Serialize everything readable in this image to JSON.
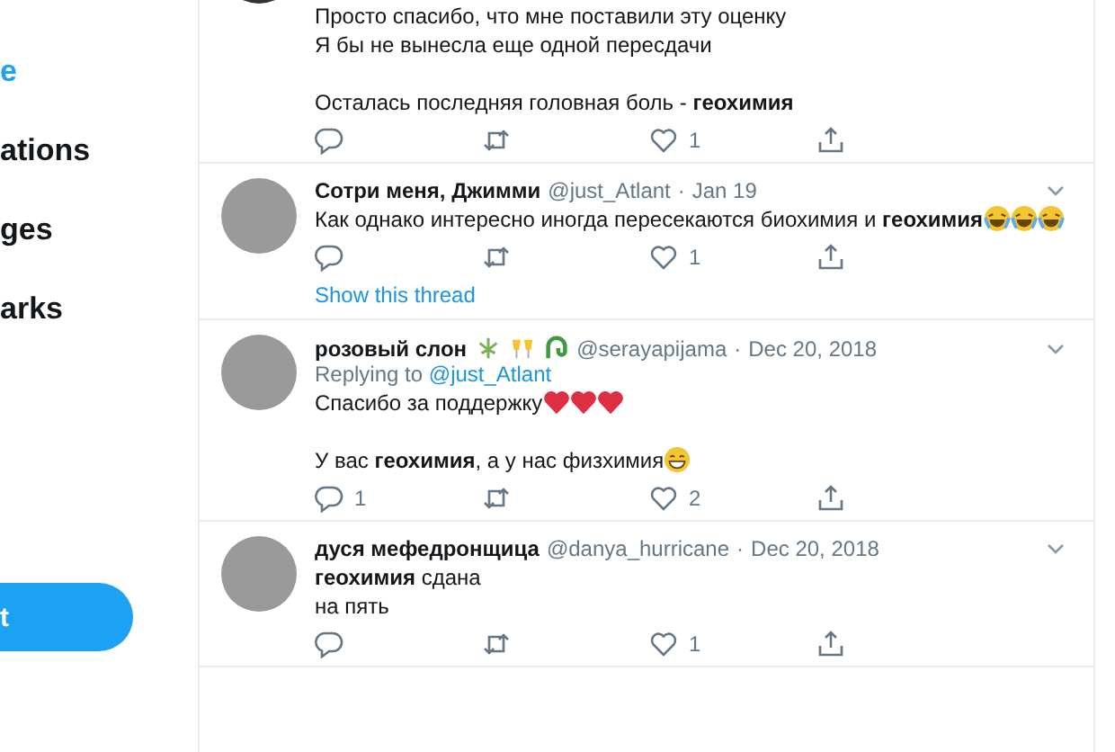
{
  "sidebar": {
    "items": [
      {
        "label": "e",
        "selected": true
      },
      {
        "label": "ations",
        "selected": false
      },
      {
        "label": "ges",
        "selected": false
      },
      {
        "label": "arks",
        "selected": false
      }
    ],
    "button": "t"
  },
  "tweets": [
    {
      "paragraphs": [
        {
          "text": "Просто спасибо, что мне поставили эту оценку\nЯ бы не вынесла еще одной пересдачи"
        },
        {
          "text": "Осталась последняя головная боль - **геохимия**"
        }
      ],
      "actions": {
        "likes": "1"
      }
    },
    {
      "name": "Сотри меня, Джимми",
      "handle": "@just_Atlant",
      "separator": "·",
      "date": "Jan 19",
      "paragraphs": [
        {
          "text": "Как однако интересно иногда пересекаются биохимия и **геохимия**",
          "emojis": [
            {
              "kind": "laugh"
            },
            {
              "kind": "laugh"
            },
            {
              "kind": "laugh"
            }
          ]
        }
      ],
      "actions": {
        "likes": "1"
      },
      "show_thread": "Show this thread"
    },
    {
      "name": "розовый слон",
      "name_emojis": [
        {
          "kind": "herb"
        },
        {
          "kind": "glasses"
        },
        {
          "kind": "snake"
        }
      ],
      "handle": "@serayapijama",
      "separator": "·",
      "date": "Dec 20, 2018",
      "replying_label": "Replying to",
      "replying_to": "@just_Atlant",
      "paragraphs": [
        {
          "text": "Спасибо за поддержку",
          "emojis": [
            {
              "kind": "heart"
            },
            {
              "kind": "heart"
            },
            {
              "kind": "heart"
            }
          ]
        },
        {
          "text": "У вас **геохимия**, а у нас физхимия",
          "emojis": [
            {
              "kind": "grin"
            }
          ]
        }
      ],
      "actions": {
        "replies": "1",
        "likes": "2"
      }
    },
    {
      "name": "дуся мефедронщица",
      "handle": "@danya_hurricane",
      "separator": "·",
      "date": "Dec 20, 2018",
      "paragraphs": [
        {
          "text": "**геохимия** сдана\nна пять"
        }
      ],
      "actions": {
        "likes": "1"
      }
    }
  ]
}
